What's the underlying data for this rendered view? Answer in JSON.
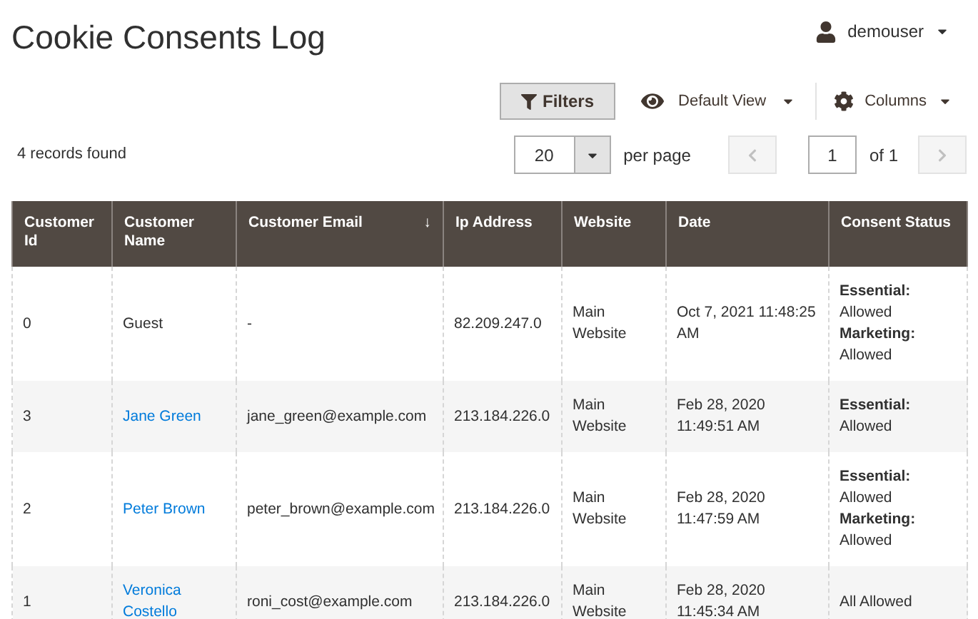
{
  "page_title": "Cookie Consents Log",
  "user_menu": {
    "username": "demouser"
  },
  "toolbar": {
    "filters_button": "Filters",
    "view_menu": "Default View",
    "columns_menu": "Columns"
  },
  "records_found": "4 records found",
  "pagination": {
    "per_page_value": "20",
    "per_page_label": "per page",
    "page_value": "1",
    "page_total": "of 1"
  },
  "table": {
    "columns": [
      {
        "label": "Customer Id"
      },
      {
        "label": "Customer Name"
      },
      {
        "label": "Customer Email",
        "sort_indicator": "↓"
      },
      {
        "label": "Ip Address"
      },
      {
        "label": "Website"
      },
      {
        "label": "Date"
      },
      {
        "label": "Consent Status"
      }
    ],
    "rows": [
      {
        "customer_id": "0",
        "customer_name": "Guest",
        "name_is_link": false,
        "email": "-",
        "ip": "82.209.247.0",
        "website": "Main Website",
        "date": "Oct 7, 2021 11:48:25 AM",
        "consent": [
          {
            "label": "Essential:",
            "value": "Allowed"
          },
          {
            "label": "Marketing:",
            "value": "Allowed"
          }
        ]
      },
      {
        "customer_id": "3",
        "customer_name": "Jane Green",
        "name_is_link": true,
        "email": "jane_green@example.com",
        "ip": "213.184.226.0",
        "website": "Main Website",
        "date": "Feb 28, 2020 11:49:51 AM",
        "consent": [
          {
            "label": "Essential:",
            "value": "Allowed"
          }
        ]
      },
      {
        "customer_id": "2",
        "customer_name": "Peter Brown",
        "name_is_link": true,
        "email": "peter_brown@example.com",
        "ip": "213.184.226.0",
        "website": "Main Website",
        "date": "Feb 28, 2020 11:47:59 AM",
        "consent": [
          {
            "label": "Essential:",
            "value": "Allowed"
          },
          {
            "label": "Marketing:",
            "value": "Allowed"
          }
        ]
      },
      {
        "customer_id": "1",
        "customer_name": "Veronica Costello",
        "name_is_link": true,
        "email": "roni_cost@example.com",
        "ip": "213.184.226.0",
        "website": "Main Website",
        "date": "Feb 28, 2020 11:45:34 AM",
        "consent": [
          {
            "value": "All Allowed"
          }
        ]
      }
    ]
  }
}
